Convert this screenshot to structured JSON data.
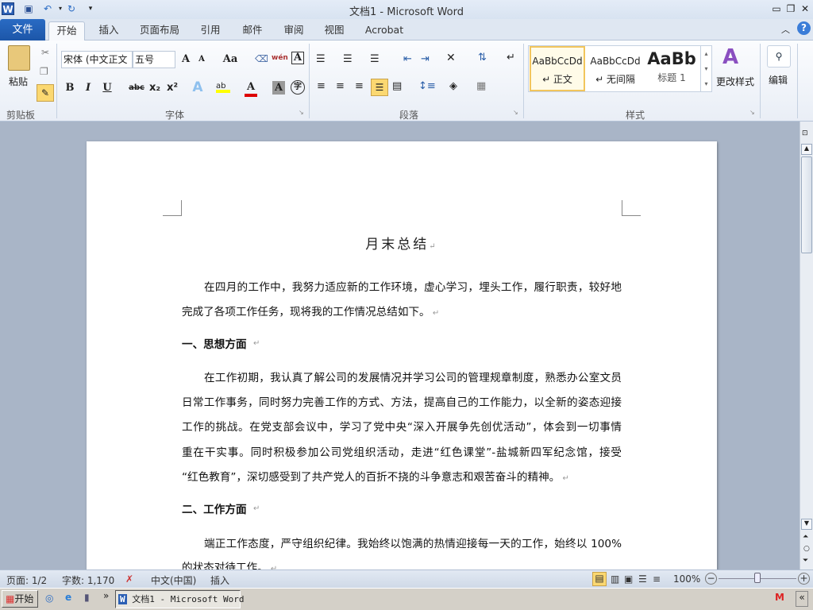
{
  "window": {
    "title": "文档1  -  Microsoft Word"
  },
  "quick_access": {
    "word_icon": "word-icon",
    "save": "save-icon",
    "undo": "undo-icon",
    "redo": "redo-icon"
  },
  "tabs": {
    "file": "文件",
    "items": [
      "开始",
      "插入",
      "页面布局",
      "引用",
      "邮件",
      "审阅",
      "视图",
      "Acrobat"
    ]
  },
  "ribbon": {
    "clipboard": {
      "paste": "粘贴",
      "label": "剪贴板"
    },
    "font": {
      "font_name": "宋体 (中文正文",
      "font_size": "五号",
      "label": "字体",
      "grow": "A",
      "shrink": "A",
      "case": "Aa",
      "bold": "B",
      "italic": "I",
      "underline": "U",
      "strike": "abc",
      "sub": "x₂",
      "sup": "x²",
      "wen": "wén",
      "char_border": "A",
      "font_color": "A",
      "char_shade": "A",
      "enclose": "字"
    },
    "paragraph": {
      "label": "段落"
    },
    "styles": {
      "label": "样式",
      "items": [
        {
          "preview": "AaBbCcDd",
          "name": "↵ 正文"
        },
        {
          "preview": "AaBbCcDd",
          "name": "↵ 无间隔"
        },
        {
          "preview": "AaBb",
          "name": "标题 1"
        }
      ],
      "change": "更改样式"
    },
    "editing": {
      "label": "编辑"
    }
  },
  "document": {
    "title": "月末总结",
    "blocks": [
      {
        "type": "p",
        "lines": [
          "在四月的工作中，我努力适应新的工作环境，虚心学习，埋头工作，履行职责，较好地",
          "完成了各项工作任务，现将我的工作情况总结如下。"
        ]
      },
      {
        "type": "h",
        "text": "一、思想方面"
      },
      {
        "type": "p",
        "lines": [
          "在工作初期，我认真了解公司的发展情况并学习公司的管理规章制度，熟悉办公室文员",
          "日常工作事务，同时努力完善工作的方式、方法，提高自己的工作能力，以全新的姿态迎接",
          "工作的挑战。在党支部会议中，学习了党中央“深入开展争先创优活动”，体会到一切事情",
          "重在干实事。同时积极参加公司党组织活动，走进“红色课堂”-盐城新四军纪念馆，接受",
          "“红色教育”，深切感受到了共产党人的百折不挠的斗争意志和艰苦奋斗的精神。"
        ]
      },
      {
        "type": "h",
        "text": "二、工作方面"
      },
      {
        "type": "p",
        "lines": [
          "端正工作态度，严守组织纪律。我始终以饱满的热情迎接每一天的工作，始终以 100%",
          "的状态对待工作。"
        ]
      }
    ]
  },
  "status": {
    "page": "页面: 1/2",
    "words": "字数: 1,170",
    "lang": "中文(中国)",
    "mode": "插入",
    "zoom": "100%",
    "zoom_value": 100
  },
  "taskbar": {
    "start": "开始",
    "task": "文档1 - Microsoft Word",
    "more": "»",
    "collapse": "«"
  }
}
